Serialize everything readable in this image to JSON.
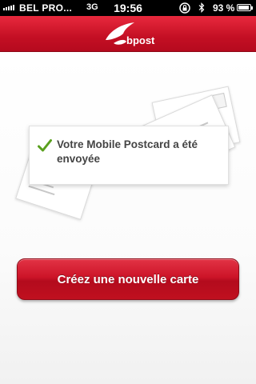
{
  "status_bar": {
    "carrier": "BEL PRO...",
    "network": "3G",
    "time": "19:56",
    "battery": "93 %",
    "battery_level": 0.93,
    "signal_icon": "signal-bars-icon",
    "lock_icon": "rotation-lock-icon",
    "bluetooth_icon": "bluetooth-icon"
  },
  "header": {
    "logo_text": "bpost",
    "logo_icon": "bpost-horn-logo",
    "color": "#d0142a"
  },
  "confirmation": {
    "icon": "check-icon",
    "check_color": "#5aa01e",
    "message": "Votre Mobile Postcard a été envoyée"
  },
  "actions": {
    "create_label": "Créez une nouvelle carte",
    "button_color": "#cc1428"
  }
}
